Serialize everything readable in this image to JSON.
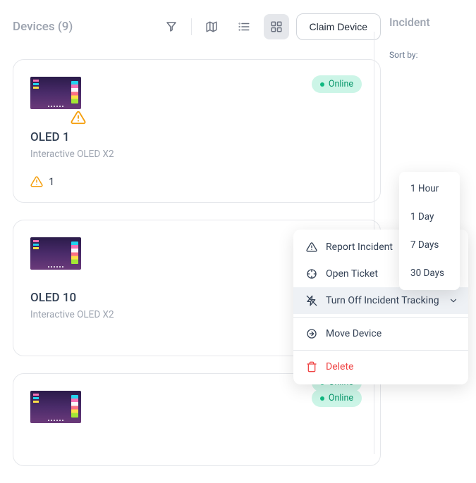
{
  "header": {
    "title": "Devices (9)",
    "claim_label": "Claim Device"
  },
  "devices": [
    {
      "name": "OLED 1",
      "model": "Interactive OLED X2",
      "status": "Online",
      "warn_count": "1"
    },
    {
      "name": "OLED 10",
      "model": "Interactive OLED X2",
      "status": "Online"
    },
    {
      "name": "",
      "model": "",
      "status": "Online"
    }
  ],
  "side": {
    "heading": "Incident",
    "sort_label": "Sort by:"
  },
  "context_menu": {
    "report_incident": "Report Incident",
    "open_ticket": "Open Ticket",
    "turn_off_tracking": "Turn Off Incident Tracking",
    "move_device": "Move Device",
    "delete": "Delete"
  },
  "duration_menu": {
    "items": [
      "1 Hour",
      "1 Day",
      "7 Days",
      "30 Days"
    ]
  },
  "icons": {
    "filter": "filter-icon",
    "map": "map-icon",
    "list": "list-icon",
    "grid": "grid-icon",
    "warn": "alert-triangle-icon",
    "crosshair": "crosshair-icon",
    "zap_off": "zap-off-icon",
    "move": "move-icon",
    "trash": "trash-icon",
    "chevron_down": "chevron-down-icon"
  },
  "colors": {
    "accent_green": "#10b981",
    "warn_orange": "#f59e0b",
    "danger_red": "#ef4444",
    "text_muted": "#9ca3af"
  }
}
